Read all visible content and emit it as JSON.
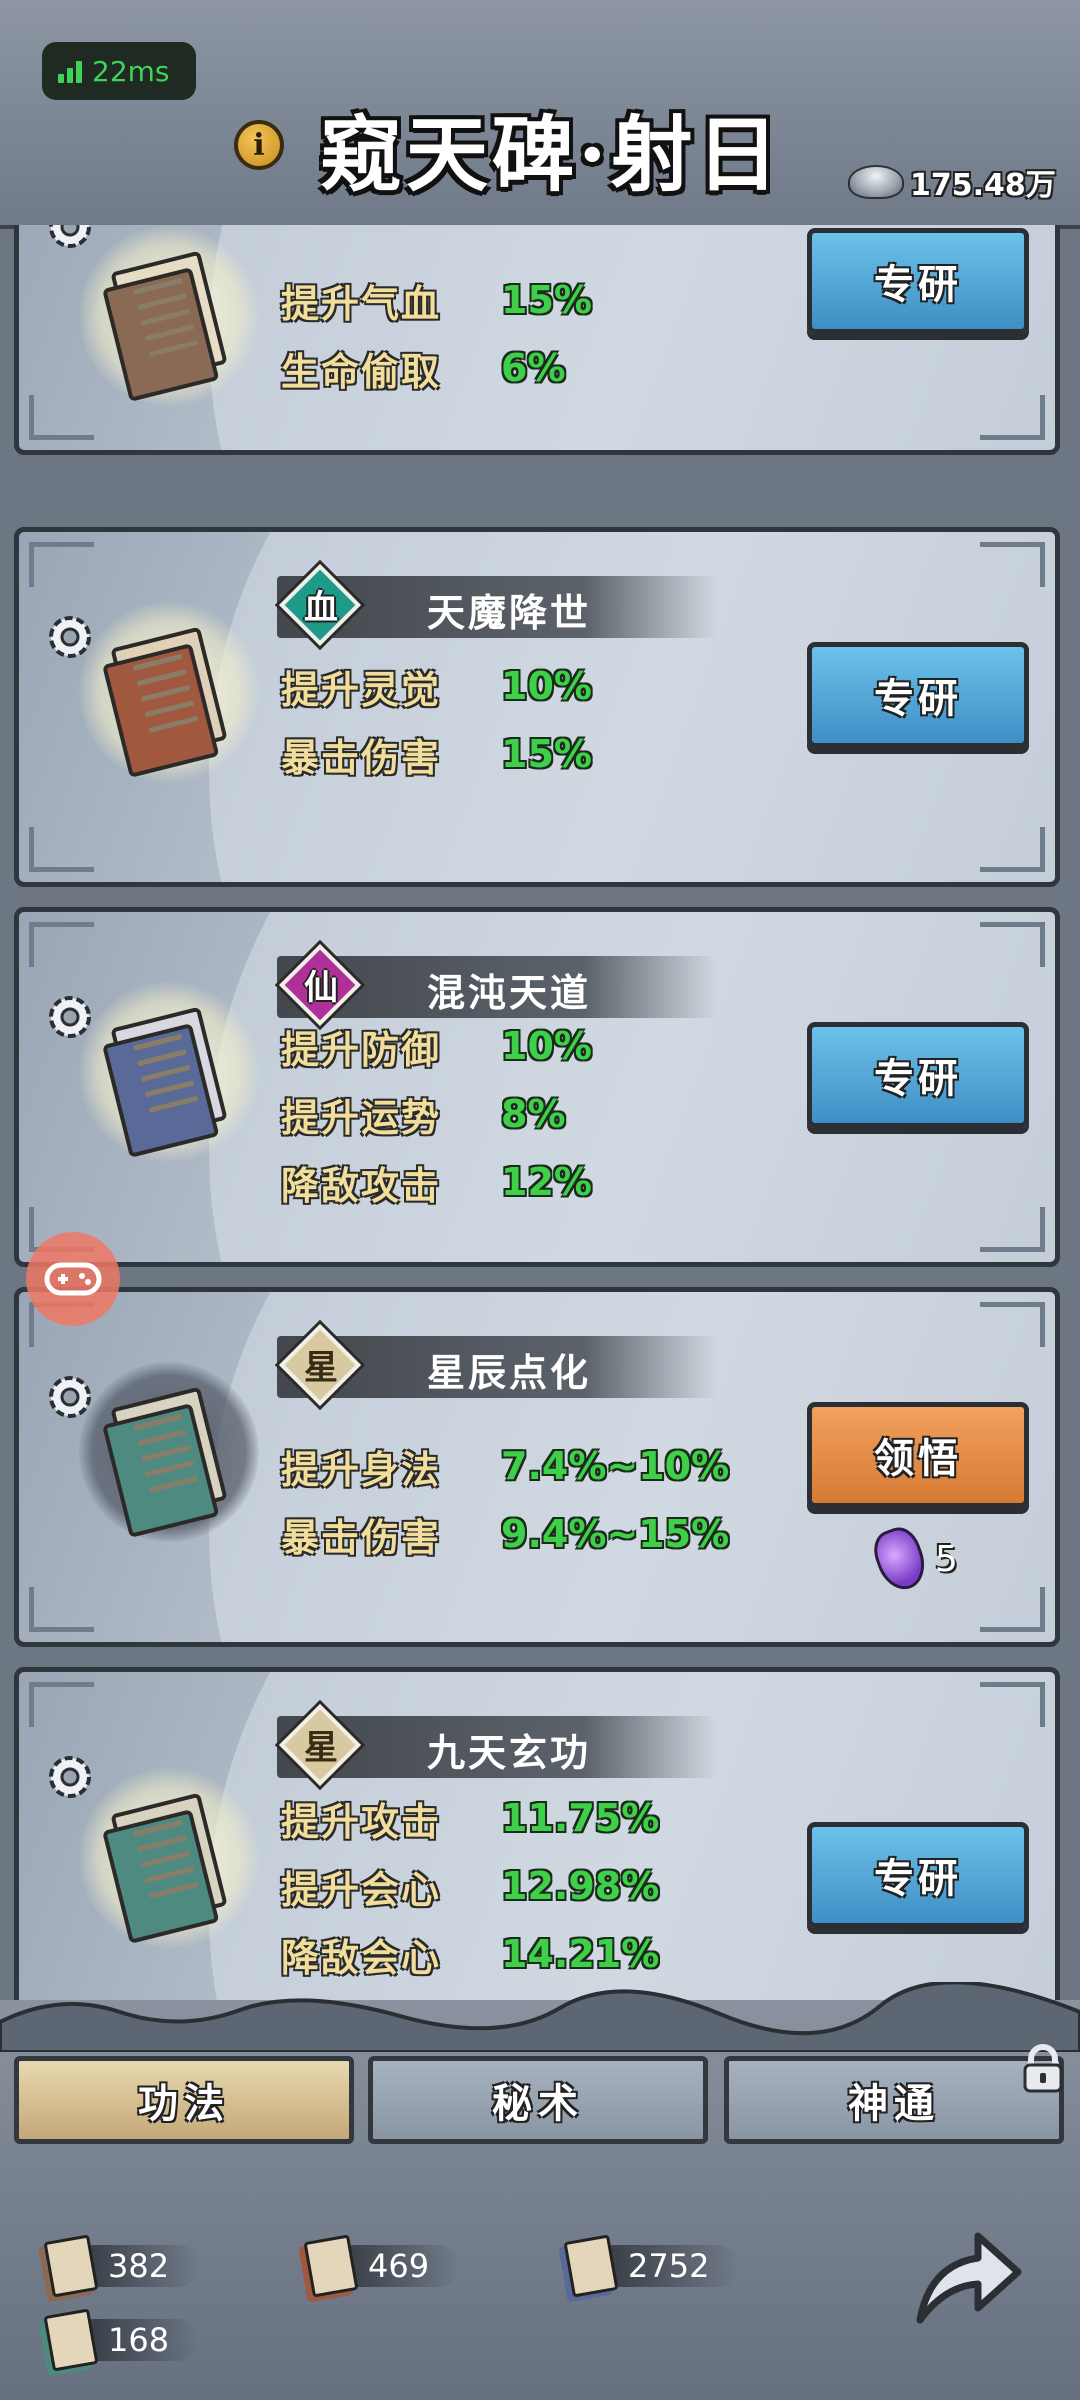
{
  "status": {
    "ping": "22ms"
  },
  "header": {
    "title": "窥天碑·射日",
    "info_icon": "i",
    "currency": "175.48万"
  },
  "cards": [
    {
      "badge": "",
      "name": "",
      "stats": [
        {
          "label": "提升气血",
          "value": "15%"
        },
        {
          "label": "生命偷取",
          "value": "6%"
        }
      ],
      "button": "专研",
      "book_color": "#8a6a55"
    },
    {
      "badge": "血",
      "badge_color": "#1e9a8a",
      "name": "天魔降世",
      "stats": [
        {
          "label": "提升灵觉",
          "value": "10%"
        },
        {
          "label": "暴击伤害",
          "value": "15%"
        }
      ],
      "button": "专研",
      "book_color": "#a0593f"
    },
    {
      "badge": "仙",
      "badge_color": "#b0309a",
      "name": "混沌天道",
      "stats": [
        {
          "label": "提升防御",
          "value": "10%"
        },
        {
          "label": "提升运势",
          "value": "8%"
        },
        {
          "label": "降敌攻击",
          "value": "12%"
        }
      ],
      "button": "专研",
      "book_color": "#5a6a98"
    },
    {
      "badge": "星",
      "badge_color": "#9c7a3c",
      "name": "星辰点化",
      "stats": [
        {
          "label": "提升身法",
          "value": "7.4%~10%"
        },
        {
          "label": "暴击伤害",
          "value": "9.4%~15%"
        }
      ],
      "button": "领悟",
      "cost": "5",
      "book_color": "#4e8a80"
    },
    {
      "badge": "星",
      "badge_color": "#9c7a3c",
      "name": "九天玄功",
      "stats": [
        {
          "label": "提升攻击",
          "value": "11.75%"
        },
        {
          "label": "提升会心",
          "value": "12.98%"
        },
        {
          "label": "降敌会心",
          "value": "14.21%"
        }
      ],
      "button": "专研",
      "book_color": "#4e8a80"
    }
  ],
  "tabs": [
    {
      "label": "功法",
      "active": true
    },
    {
      "label": "秘术",
      "active": false
    },
    {
      "label": "神通",
      "active": false,
      "locked": true
    }
  ],
  "resources": [
    {
      "value": "382",
      "color": "#8a6a55"
    },
    {
      "value": "469",
      "color": "#a0593f"
    },
    {
      "value": "2752",
      "color": "#5a6a98"
    },
    {
      "value": "168",
      "color": "#4e8a80"
    }
  ],
  "icons": [
    "signal-icon",
    "info-icon",
    "silver-ingot-icon",
    "gear-icon",
    "scroll-book-icon",
    "purple-potion-icon",
    "gamepad-icon",
    "lock-icon",
    "share-arrow-icon"
  ]
}
